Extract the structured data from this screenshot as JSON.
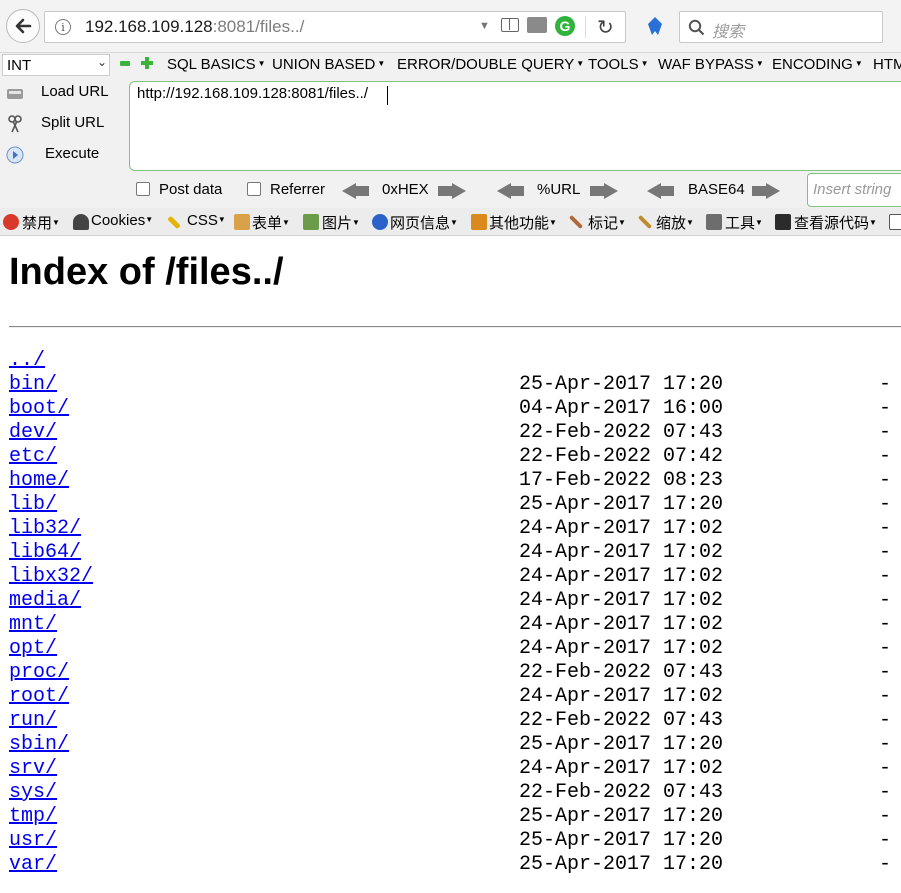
{
  "browser": {
    "url_host": "192.168.109.128",
    "url_rest": ":8081/files../",
    "search_placeholder": "搜索",
    "g_label": "G"
  },
  "hackbar": {
    "type_select": "INT",
    "menus": [
      "SQL BASICS",
      "UNION BASED",
      "ERROR/DOUBLE QUERY",
      "TOOLS",
      "WAF BYPASS",
      "ENCODING",
      "HTM"
    ],
    "load_url": "Load URL",
    "split_url": "Split URL",
    "execute": "Execute",
    "url_value": "http://192.168.109.128:8081/files../",
    "post_data": "Post data",
    "referrer": "Referrer",
    "enc_hex": "0xHEX",
    "enc_url": "%URL",
    "enc_base64": "BASE64",
    "insert_placeholder": "Insert string"
  },
  "devtoolbar": {
    "items": [
      "禁用",
      "Cookies",
      "CSS",
      "表单",
      "图片",
      "网页信息",
      "其他功能",
      "标记",
      "缩放",
      "工具",
      "查看源代码"
    ]
  },
  "page": {
    "title": "Index of /files../",
    "parent_link": "../",
    "entries": [
      {
        "name": "bin/",
        "date": "25-Apr-2017 17:20",
        "size": "-"
      },
      {
        "name": "boot/",
        "date": "04-Apr-2017 16:00",
        "size": "-"
      },
      {
        "name": "dev/",
        "date": "22-Feb-2022 07:43",
        "size": "-"
      },
      {
        "name": "etc/",
        "date": "22-Feb-2022 07:42",
        "size": "-"
      },
      {
        "name": "home/",
        "date": "17-Feb-2022 08:23",
        "size": "-"
      },
      {
        "name": "lib/",
        "date": "25-Apr-2017 17:20",
        "size": "-"
      },
      {
        "name": "lib32/",
        "date": "24-Apr-2017 17:02",
        "size": "-"
      },
      {
        "name": "lib64/",
        "date": "24-Apr-2017 17:02",
        "size": "-"
      },
      {
        "name": "libx32/",
        "date": "24-Apr-2017 17:02",
        "size": "-"
      },
      {
        "name": "media/",
        "date": "24-Apr-2017 17:02",
        "size": "-"
      },
      {
        "name": "mnt/",
        "date": "24-Apr-2017 17:02",
        "size": "-"
      },
      {
        "name": "opt/",
        "date": "24-Apr-2017 17:02",
        "size": "-"
      },
      {
        "name": "proc/",
        "date": "22-Feb-2022 07:43",
        "size": "-"
      },
      {
        "name": "root/",
        "date": "24-Apr-2017 17:02",
        "size": "-"
      },
      {
        "name": "run/",
        "date": "22-Feb-2022 07:43",
        "size": "-"
      },
      {
        "name": "sbin/",
        "date": "25-Apr-2017 17:20",
        "size": "-"
      },
      {
        "name": "srv/",
        "date": "24-Apr-2017 17:02",
        "size": "-"
      },
      {
        "name": "sys/",
        "date": "22-Feb-2022 07:43",
        "size": "-"
      },
      {
        "name": "tmp/",
        "date": "25-Apr-2017 17:20",
        "size": "-"
      },
      {
        "name": "usr/",
        "date": "25-Apr-2017 17:20",
        "size": "-"
      },
      {
        "name": "var/",
        "date": "25-Apr-2017 17:20",
        "size": "-"
      }
    ]
  }
}
